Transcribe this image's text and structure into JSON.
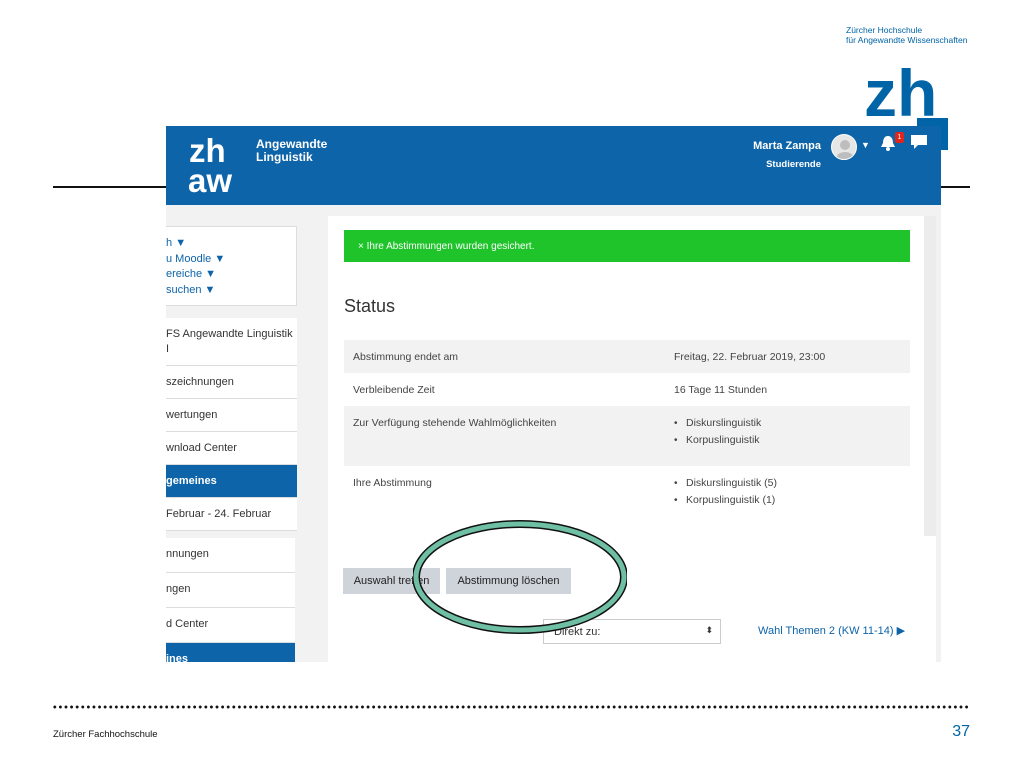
{
  "slide": {
    "university_line1": "Zürcher Hochschule",
    "university_line2": "für Angewandte Wissenschaften",
    "logo_text": "zh",
    "footer": "Zürcher  Fachhochschule",
    "page_number": "37"
  },
  "header": {
    "brand_logo": "zh aw",
    "brand_line1": "Angewandte",
    "brand_line2": "Linguistik",
    "user_name": "Marta Zampa",
    "user_role": "Studierende",
    "notification_count": "1",
    "user_caret": "▼",
    "colors": {
      "bar": "#0e64a9",
      "badge": "#e0251b"
    }
  },
  "nav": {
    "items": [
      {
        "label": "h",
        "caret": "▼"
      },
      {
        "label": "u Moodle",
        "caret": "▼"
      },
      {
        "label": "ereiche",
        "caret": "▼"
      },
      {
        "label": "suchen",
        "caret": "▼"
      }
    ]
  },
  "course_nav": {
    "items": [
      {
        "label": "FS Angewandte Linguistik I"
      },
      {
        "label": "szeichnungen"
      },
      {
        "label": "wertungen"
      },
      {
        "label": "wnload Center"
      },
      {
        "label": "gemeines",
        "active": true
      },
      {
        "label": " Februar - 24. Februar"
      }
    ],
    "lower_items": [
      {
        "label": "nnungen"
      },
      {
        "label": "ngen"
      },
      {
        "label": "d Center"
      },
      {
        "label": "ines",
        "active": true
      }
    ]
  },
  "alert": {
    "text": "× Ihre Abstimmungen wurden gesichert.",
    "color": "#1fc42b"
  },
  "status": {
    "title": "Status",
    "rows": [
      {
        "label": "Abstimmung endet am",
        "value": "Freitag, 22. Februar 2019, 23:00"
      },
      {
        "label": "Verbleibende Zeit",
        "value": "16 Tage 11 Stunden"
      },
      {
        "label": "Zur Verfügung stehende Wahlmöglichkeiten",
        "values": [
          "Diskurslinguistik",
          "Korpuslinguistik"
        ]
      },
      {
        "label": "Ihre Abstimmung",
        "values": [
          "Diskurslinguistik (5)",
          "Korpuslinguistik (1)"
        ]
      }
    ]
  },
  "actions": {
    "choose_label": "Auswahl treffen",
    "delete_label": "Abstimmung löschen"
  },
  "footer_nav": {
    "jump_label": "Direkt zu:",
    "jump_arrow": "⬍",
    "next_label": "Wahl Themen 2 (KW 11-14) ▶"
  },
  "annotation": {
    "ring_color": "#6fbfa5"
  }
}
